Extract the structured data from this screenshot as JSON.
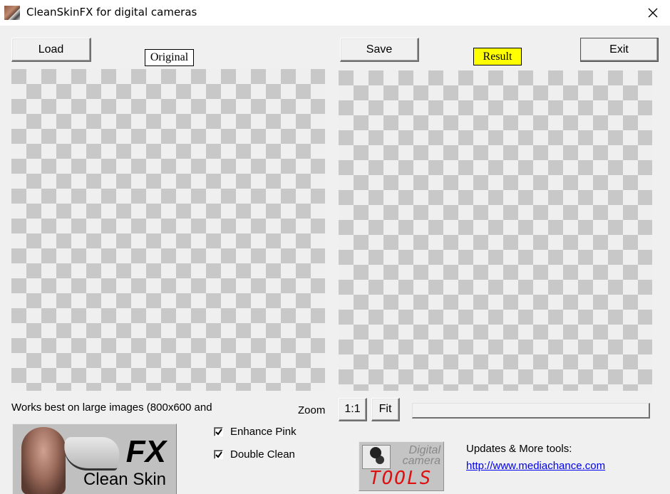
{
  "window": {
    "title": "CleanSkinFX for digital cameras",
    "close_icon": "close-icon"
  },
  "toolbar": {
    "load_label": "Load",
    "save_label": "Save",
    "exit_label": "Exit"
  },
  "panels": {
    "original_label": "Original",
    "result_label": "Result",
    "result_label_color": "#ffff00"
  },
  "footer": {
    "hint_text": "Works best on large images (800x600 and",
    "zoom_label": "Zoom",
    "zoom_1to1_label": "1:1",
    "zoom_fit_label": "Fit",
    "progress_percent": 0,
    "progress_color": "#06b025"
  },
  "options": [
    {
      "label": "Enhance Pink",
      "checked": true
    },
    {
      "label": "Double Clean",
      "checked": true
    }
  ],
  "logo_cleanskin": {
    "fx_text": "FX",
    "name_text": "Clean Skin"
  },
  "logo_dct": {
    "line1": "Digital",
    "line2": "camera",
    "line3": "TOOLS",
    "tools_color": "#e01010"
  },
  "links": {
    "updates_label": "Updates & More tools:",
    "url_text": "http://www.mediachance.com"
  }
}
